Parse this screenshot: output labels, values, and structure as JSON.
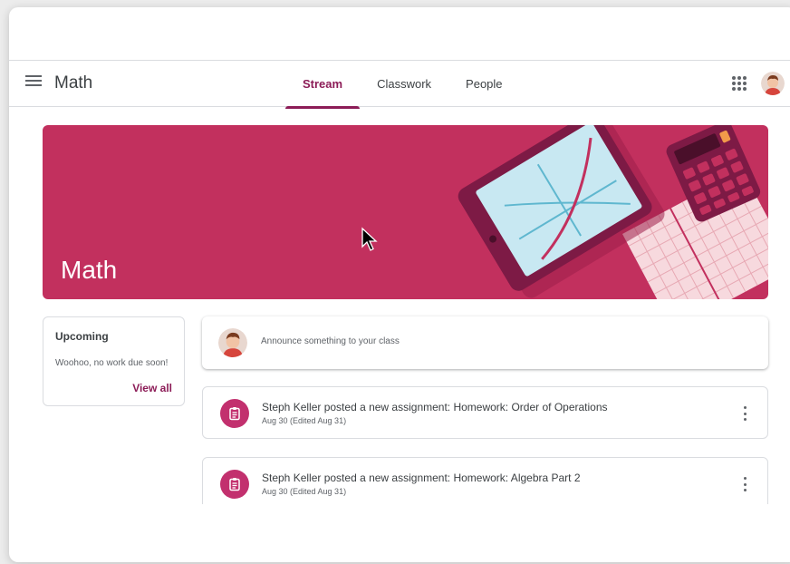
{
  "app": {
    "title": "Math"
  },
  "tabs": [
    {
      "label": "Stream",
      "active": true
    },
    {
      "label": "Classwork",
      "active": false
    },
    {
      "label": "People",
      "active": false
    }
  ],
  "header_icons": {
    "menu": "menu-icon",
    "apps": "apps-grid-icon",
    "account": "avatar"
  },
  "banner": {
    "title": "Math",
    "color": "#c2305e"
  },
  "upcoming": {
    "title": "Upcoming",
    "text": "Woohoo, no work due soon!",
    "link": "View all"
  },
  "announce": {
    "placeholder": "Announce something to your class"
  },
  "posts": [
    {
      "title": "Steph Keller posted a new assignment: Homework: Order of Operations",
      "date": "Aug 30 (Edited Aug 31)"
    },
    {
      "title": "Steph Keller posted a new assignment: Homework: Algebra Part 2",
      "date": "Aug 30 (Edited Aug 31)"
    }
  ],
  "colors": {
    "accent": "#8c1c57",
    "assignment_icon": "#c2306e"
  }
}
